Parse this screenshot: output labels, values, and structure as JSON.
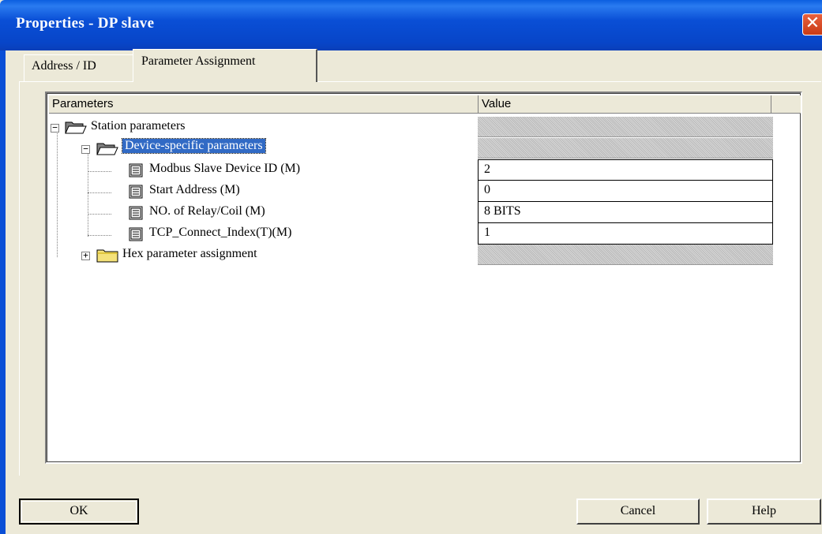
{
  "window": {
    "title": "Properties - DP slave",
    "close_glyph": "✕"
  },
  "tabs": [
    {
      "label": "Address / ID",
      "active": false
    },
    {
      "label": "Parameter Assignment",
      "active": true
    }
  ],
  "tree": {
    "columns": [
      "Parameters",
      "Value"
    ],
    "rows": [
      {
        "label": "Station parameters",
        "value": "",
        "icon": "open-folder-icon",
        "expander": "−"
      },
      {
        "label": "Device-specific parameters",
        "value": "",
        "icon": "open-folder-icon",
        "expander": "−",
        "selected": true
      },
      {
        "label": "Modbus Slave Device ID (M)",
        "value": "2",
        "icon": "parameter-icon"
      },
      {
        "label": "Start Address (M)",
        "value": "0",
        "icon": "parameter-icon"
      },
      {
        "label": "NO. of Relay/Coil (M)",
        "value": "8 BITS",
        "icon": "parameter-icon"
      },
      {
        "label": "TCP_Connect_Index(T)(M)",
        "value": "1",
        "icon": "parameter-icon"
      },
      {
        "label": "Hex parameter assignment",
        "value": "",
        "icon": "closed-folder-icon",
        "expander": "+"
      }
    ]
  },
  "buttons": {
    "ok": "OK",
    "cancel": "Cancel",
    "help": "Help"
  },
  "colors": {
    "titlebar": "#0a4fd6",
    "selection": "#316ac5",
    "dialog_bg": "#ece9d8"
  }
}
